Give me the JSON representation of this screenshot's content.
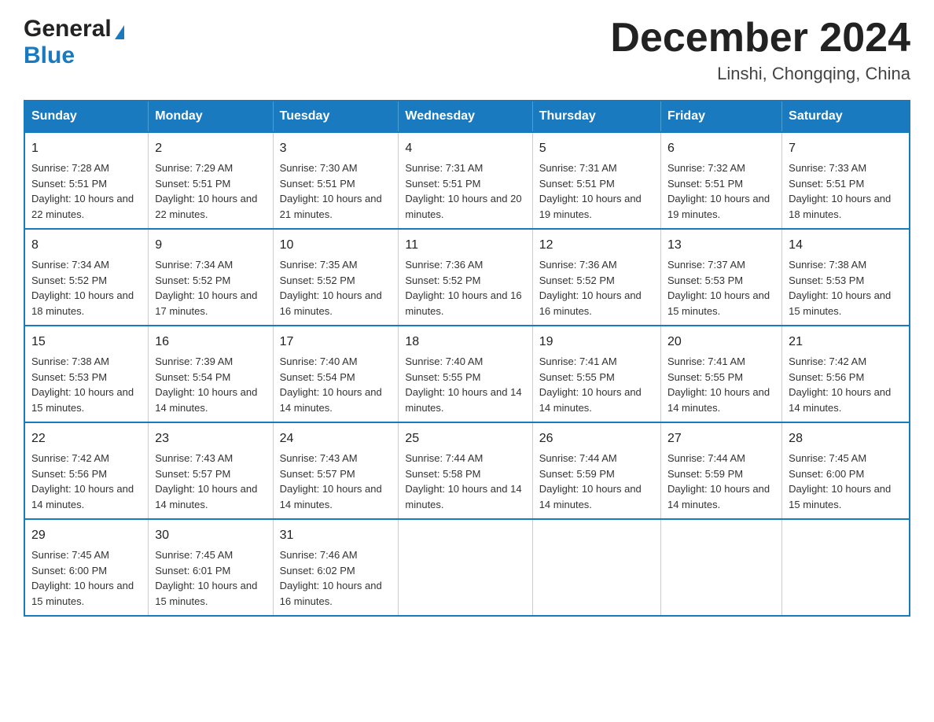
{
  "header": {
    "logo_general": "General",
    "logo_blue": "Blue",
    "month_title": "December 2024",
    "location": "Linshi, Chongqing, China"
  },
  "days_of_week": [
    "Sunday",
    "Monday",
    "Tuesday",
    "Wednesday",
    "Thursday",
    "Friday",
    "Saturday"
  ],
  "weeks": [
    [
      {
        "day": "1",
        "sunrise": "Sunrise: 7:28 AM",
        "sunset": "Sunset: 5:51 PM",
        "daylight": "Daylight: 10 hours and 22 minutes."
      },
      {
        "day": "2",
        "sunrise": "Sunrise: 7:29 AM",
        "sunset": "Sunset: 5:51 PM",
        "daylight": "Daylight: 10 hours and 22 minutes."
      },
      {
        "day": "3",
        "sunrise": "Sunrise: 7:30 AM",
        "sunset": "Sunset: 5:51 PM",
        "daylight": "Daylight: 10 hours and 21 minutes."
      },
      {
        "day": "4",
        "sunrise": "Sunrise: 7:31 AM",
        "sunset": "Sunset: 5:51 PM",
        "daylight": "Daylight: 10 hours and 20 minutes."
      },
      {
        "day": "5",
        "sunrise": "Sunrise: 7:31 AM",
        "sunset": "Sunset: 5:51 PM",
        "daylight": "Daylight: 10 hours and 19 minutes."
      },
      {
        "day": "6",
        "sunrise": "Sunrise: 7:32 AM",
        "sunset": "Sunset: 5:51 PM",
        "daylight": "Daylight: 10 hours and 19 minutes."
      },
      {
        "day": "7",
        "sunrise": "Sunrise: 7:33 AM",
        "sunset": "Sunset: 5:51 PM",
        "daylight": "Daylight: 10 hours and 18 minutes."
      }
    ],
    [
      {
        "day": "8",
        "sunrise": "Sunrise: 7:34 AM",
        "sunset": "Sunset: 5:52 PM",
        "daylight": "Daylight: 10 hours and 18 minutes."
      },
      {
        "day": "9",
        "sunrise": "Sunrise: 7:34 AM",
        "sunset": "Sunset: 5:52 PM",
        "daylight": "Daylight: 10 hours and 17 minutes."
      },
      {
        "day": "10",
        "sunrise": "Sunrise: 7:35 AM",
        "sunset": "Sunset: 5:52 PM",
        "daylight": "Daylight: 10 hours and 16 minutes."
      },
      {
        "day": "11",
        "sunrise": "Sunrise: 7:36 AM",
        "sunset": "Sunset: 5:52 PM",
        "daylight": "Daylight: 10 hours and 16 minutes."
      },
      {
        "day": "12",
        "sunrise": "Sunrise: 7:36 AM",
        "sunset": "Sunset: 5:52 PM",
        "daylight": "Daylight: 10 hours and 16 minutes."
      },
      {
        "day": "13",
        "sunrise": "Sunrise: 7:37 AM",
        "sunset": "Sunset: 5:53 PM",
        "daylight": "Daylight: 10 hours and 15 minutes."
      },
      {
        "day": "14",
        "sunrise": "Sunrise: 7:38 AM",
        "sunset": "Sunset: 5:53 PM",
        "daylight": "Daylight: 10 hours and 15 minutes."
      }
    ],
    [
      {
        "day": "15",
        "sunrise": "Sunrise: 7:38 AM",
        "sunset": "Sunset: 5:53 PM",
        "daylight": "Daylight: 10 hours and 15 minutes."
      },
      {
        "day": "16",
        "sunrise": "Sunrise: 7:39 AM",
        "sunset": "Sunset: 5:54 PM",
        "daylight": "Daylight: 10 hours and 14 minutes."
      },
      {
        "day": "17",
        "sunrise": "Sunrise: 7:40 AM",
        "sunset": "Sunset: 5:54 PM",
        "daylight": "Daylight: 10 hours and 14 minutes."
      },
      {
        "day": "18",
        "sunrise": "Sunrise: 7:40 AM",
        "sunset": "Sunset: 5:55 PM",
        "daylight": "Daylight: 10 hours and 14 minutes."
      },
      {
        "day": "19",
        "sunrise": "Sunrise: 7:41 AM",
        "sunset": "Sunset: 5:55 PM",
        "daylight": "Daylight: 10 hours and 14 minutes."
      },
      {
        "day": "20",
        "sunrise": "Sunrise: 7:41 AM",
        "sunset": "Sunset: 5:55 PM",
        "daylight": "Daylight: 10 hours and 14 minutes."
      },
      {
        "day": "21",
        "sunrise": "Sunrise: 7:42 AM",
        "sunset": "Sunset: 5:56 PM",
        "daylight": "Daylight: 10 hours and 14 minutes."
      }
    ],
    [
      {
        "day": "22",
        "sunrise": "Sunrise: 7:42 AM",
        "sunset": "Sunset: 5:56 PM",
        "daylight": "Daylight: 10 hours and 14 minutes."
      },
      {
        "day": "23",
        "sunrise": "Sunrise: 7:43 AM",
        "sunset": "Sunset: 5:57 PM",
        "daylight": "Daylight: 10 hours and 14 minutes."
      },
      {
        "day": "24",
        "sunrise": "Sunrise: 7:43 AM",
        "sunset": "Sunset: 5:57 PM",
        "daylight": "Daylight: 10 hours and 14 minutes."
      },
      {
        "day": "25",
        "sunrise": "Sunrise: 7:44 AM",
        "sunset": "Sunset: 5:58 PM",
        "daylight": "Daylight: 10 hours and 14 minutes."
      },
      {
        "day": "26",
        "sunrise": "Sunrise: 7:44 AM",
        "sunset": "Sunset: 5:59 PM",
        "daylight": "Daylight: 10 hours and 14 minutes."
      },
      {
        "day": "27",
        "sunrise": "Sunrise: 7:44 AM",
        "sunset": "Sunset: 5:59 PM",
        "daylight": "Daylight: 10 hours and 14 minutes."
      },
      {
        "day": "28",
        "sunrise": "Sunrise: 7:45 AM",
        "sunset": "Sunset: 6:00 PM",
        "daylight": "Daylight: 10 hours and 15 minutes."
      }
    ],
    [
      {
        "day": "29",
        "sunrise": "Sunrise: 7:45 AM",
        "sunset": "Sunset: 6:00 PM",
        "daylight": "Daylight: 10 hours and 15 minutes."
      },
      {
        "day": "30",
        "sunrise": "Sunrise: 7:45 AM",
        "sunset": "Sunset: 6:01 PM",
        "daylight": "Daylight: 10 hours and 15 minutes."
      },
      {
        "day": "31",
        "sunrise": "Sunrise: 7:46 AM",
        "sunset": "Sunset: 6:02 PM",
        "daylight": "Daylight: 10 hours and 16 minutes."
      },
      {
        "day": "",
        "sunrise": "",
        "sunset": "",
        "daylight": ""
      },
      {
        "day": "",
        "sunrise": "",
        "sunset": "",
        "daylight": ""
      },
      {
        "day": "",
        "sunrise": "",
        "sunset": "",
        "daylight": ""
      },
      {
        "day": "",
        "sunrise": "",
        "sunset": "",
        "daylight": ""
      }
    ]
  ]
}
